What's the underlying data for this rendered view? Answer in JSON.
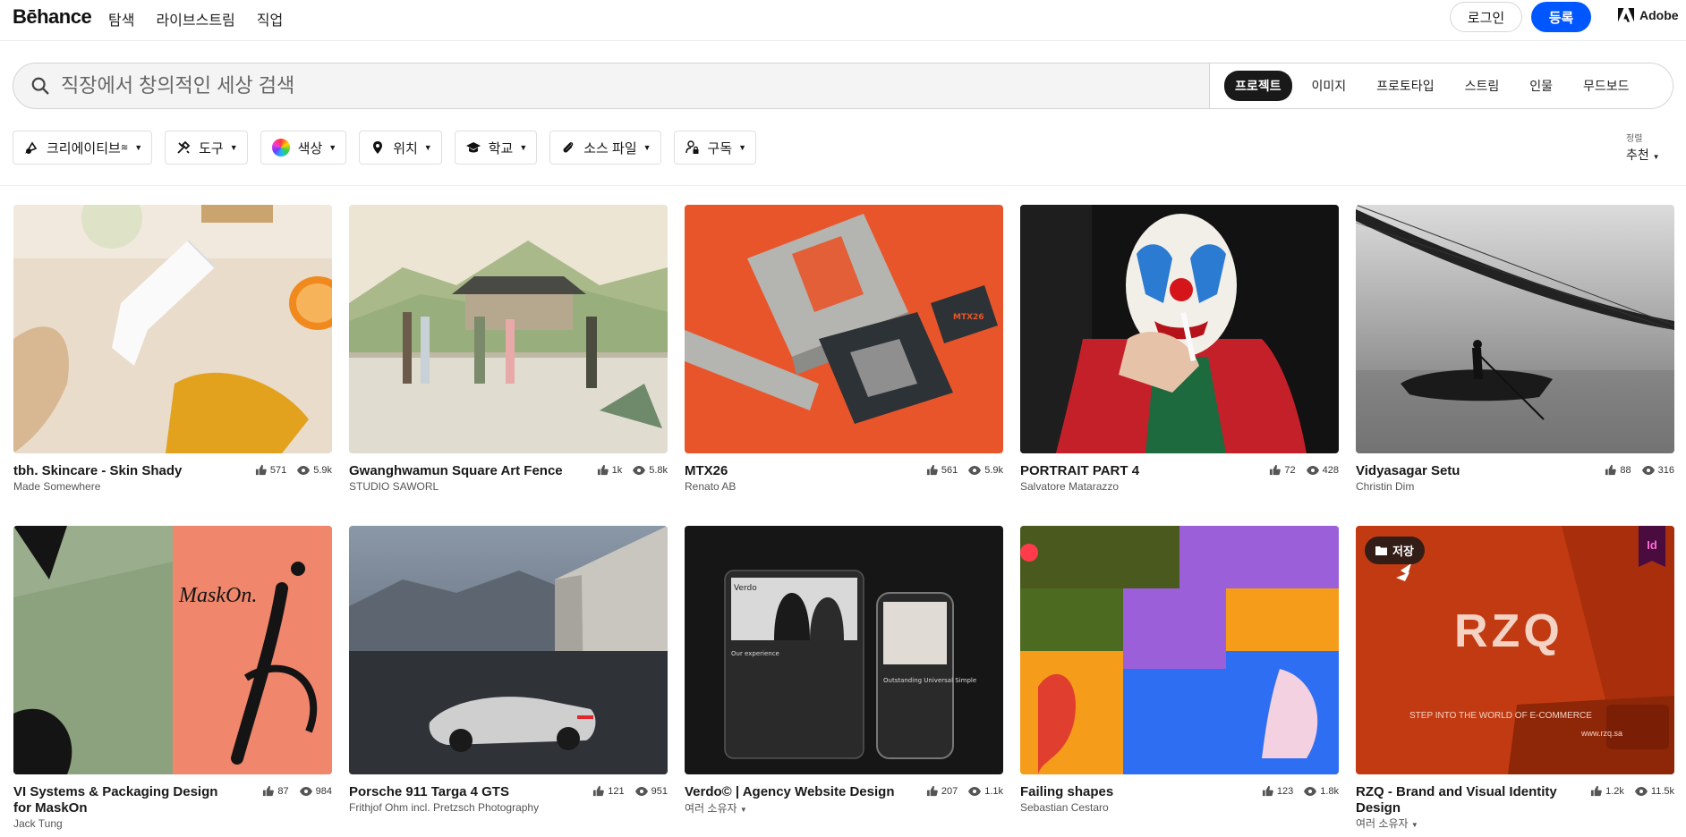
{
  "header": {
    "logo": "Bēhance",
    "nav": [
      "탐색",
      "라이브스트림",
      "직업"
    ],
    "login": "로그인",
    "signup": "등록",
    "adobe": "Adobe"
  },
  "search": {
    "placeholder": "직장에서 창의적인 세상 검색",
    "tabs": [
      "프로젝트",
      "이미지",
      "프로토타입",
      "스트림",
      "인물",
      "무드보드"
    ],
    "active_tab": "프로젝트"
  },
  "filters": {
    "creative": "크리에이티브 ",
    "tools": "도구",
    "color": "색상",
    "location": "위치",
    "school": "학교",
    "source": "소스 파일",
    "subscribe": "구독"
  },
  "sort": {
    "label": "정렬",
    "value": "추천"
  },
  "projects": [
    {
      "title": "tbh. Skincare - Skin Shady",
      "owner": "Made Somewhere",
      "likes": "571",
      "views": "5.9k"
    },
    {
      "title": "Gwanghwamun Square Art Fence",
      "owner": "STUDIO SAWORL",
      "likes": "1k",
      "views": "5.8k"
    },
    {
      "title": "MTX26",
      "owner": "Renato AB",
      "likes": "561",
      "views": "5.9k"
    },
    {
      "title": "PORTRAIT PART 4",
      "owner": "Salvatore Matarazzo",
      "likes": "72",
      "views": "428"
    },
    {
      "title": "Vidyasagar Setu",
      "owner": "Christin Dim",
      "likes": "88",
      "views": "316"
    },
    {
      "title": "VI Systems & Packaging Design for MaskOn",
      "owner": "Jack Tung",
      "likes": "87",
      "views": "984"
    },
    {
      "title": "Porsche 911 Targa 4 GTS",
      "owner": "Frithjof Ohm incl. Pretzsch Photography",
      "likes": "121",
      "views": "951"
    },
    {
      "title": "Verdo© | Agency Website Design",
      "owner": "여러 소유자",
      "likes": "207",
      "views": "1.1k"
    },
    {
      "title": "Failing shapes",
      "owner": "Sebastian Cestaro",
      "likes": "123",
      "views": "1.8k"
    },
    {
      "title": "RZQ - Brand and Visual Identity Design",
      "owner": "여러 소유자",
      "likes": "1.2k",
      "views": "11.5k"
    }
  ],
  "overlay": {
    "save": "저장",
    "id_badge": "Id",
    "rzq_logo": "RZQ",
    "rzq_tagline": "STEP INTO THE WORLD OF E-COMMERCE",
    "rzq_url": "www.rzq.sa",
    "maskon": "MaskOn.",
    "mtx": "MTX26",
    "verdo": "Verdo",
    "verdo_section": "Our experience",
    "verdo_phone": "Outstanding Universal Simple"
  }
}
